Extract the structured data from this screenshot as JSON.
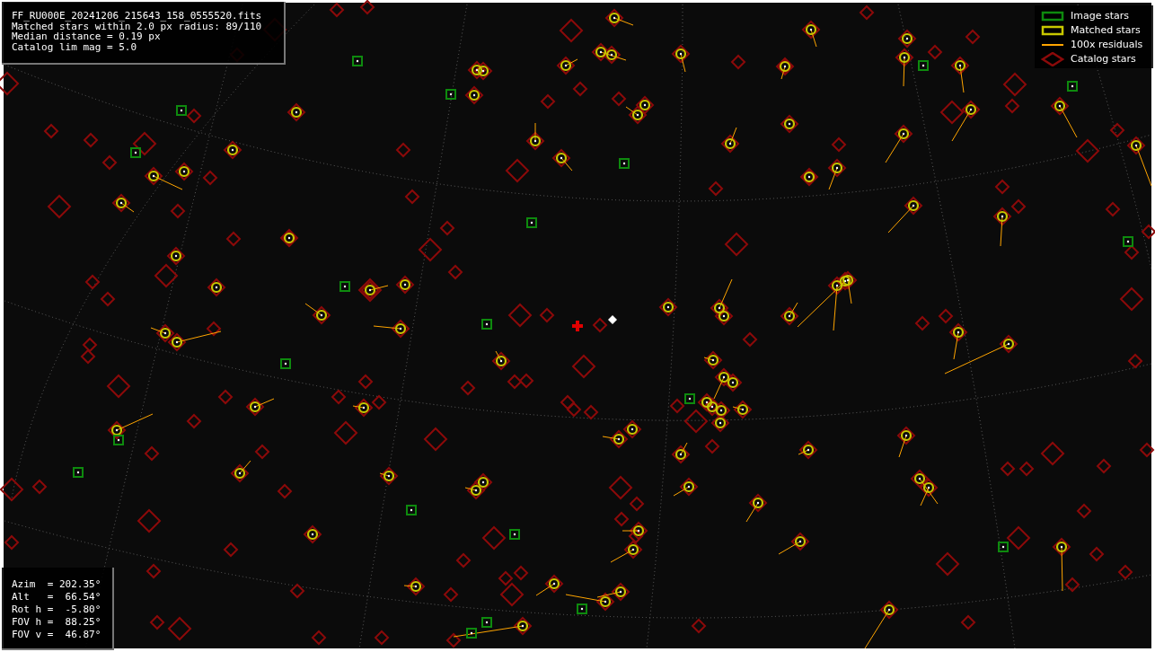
{
  "info_box": {
    "lines": [
      "FF_RU000E_20241206_215643_158_0555520.fits",
      "Matched stars within 2.0 px radius: 89/110",
      "Median distance = 0.19 px",
      "Catalog lim mag = 5.0"
    ]
  },
  "legend": {
    "items": [
      {
        "kind": "image",
        "label": "Image stars",
        "color": "#0e8a0e"
      },
      {
        "kind": "matched",
        "label": "Matched stars",
        "color": "#c8c800"
      },
      {
        "kind": "residual",
        "label": "100x residuals",
        "color": "#ffa500"
      },
      {
        "kind": "catalog",
        "label": "Catalog stars",
        "color": "#8b0a0a"
      }
    ]
  },
  "pointing_box": {
    "lines": [
      "Azim  = 202.35°",
      "Alt   =  66.54°",
      "Rot h =  -5.80°",
      "FOV h =  88.25°",
      "FOV v =  46.87°"
    ]
  }
}
